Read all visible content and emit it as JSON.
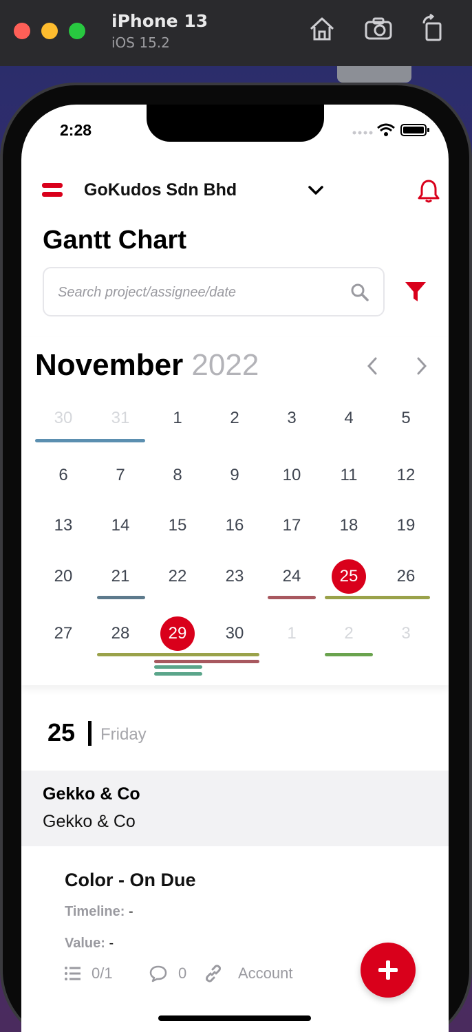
{
  "simulator": {
    "device_name": "iPhone 13",
    "os_version": "iOS 15.2",
    "home_icon": "home-icon",
    "screenshot_icon": "camera-icon",
    "rotate_icon": "rotate-icon"
  },
  "status_bar": {
    "time": "2:28"
  },
  "header": {
    "company": "GoKudos Sdn Bhd",
    "menu_icon": "hamburger-menu-icon",
    "bell_icon": "bell-icon"
  },
  "page": {
    "title": "Gantt Chart"
  },
  "search": {
    "placeholder": "Search project/assignee/date",
    "value": ""
  },
  "calendar": {
    "month": "November",
    "year": "2022",
    "weeks": [
      [
        "30",
        "31",
        "1",
        "2",
        "3",
        "4",
        "5"
      ],
      [
        "6",
        "7",
        "8",
        "9",
        "10",
        "11",
        "12"
      ],
      [
        "13",
        "14",
        "15",
        "16",
        "17",
        "18",
        "19"
      ],
      [
        "20",
        "21",
        "22",
        "23",
        "24",
        "25",
        "26"
      ],
      [
        "27",
        "28",
        "29",
        "30",
        "1",
        "2",
        "3"
      ]
    ],
    "muted_days": [
      [
        0,
        0
      ],
      [
        0,
        1
      ],
      [
        4,
        4
      ],
      [
        4,
        5
      ],
      [
        4,
        6
      ]
    ],
    "selected_days": [
      [
        3,
        5
      ],
      [
        4,
        2
      ]
    ]
  },
  "colors": {
    "accent": "#d9001b",
    "bar_blue": "#5b8fb0",
    "bar_slate": "#5d7a8c",
    "bar_rose": "#a8585f",
    "bar_olive": "#9aa24a",
    "bar_green": "#6aa34e",
    "bar_teal": "#5aa58a"
  },
  "selected_date": {
    "day": "25",
    "weekday": "Friday"
  },
  "group": {
    "title": "Gekko & Co",
    "subtitle": "Gekko & Co"
  },
  "task": {
    "title": "Color - On Due",
    "timeline_label": "Timeline:",
    "timeline_value": "-",
    "value_label": "Value:",
    "value_value": "-",
    "checklist": "0/1",
    "comments": "0",
    "link_label": "Account"
  }
}
